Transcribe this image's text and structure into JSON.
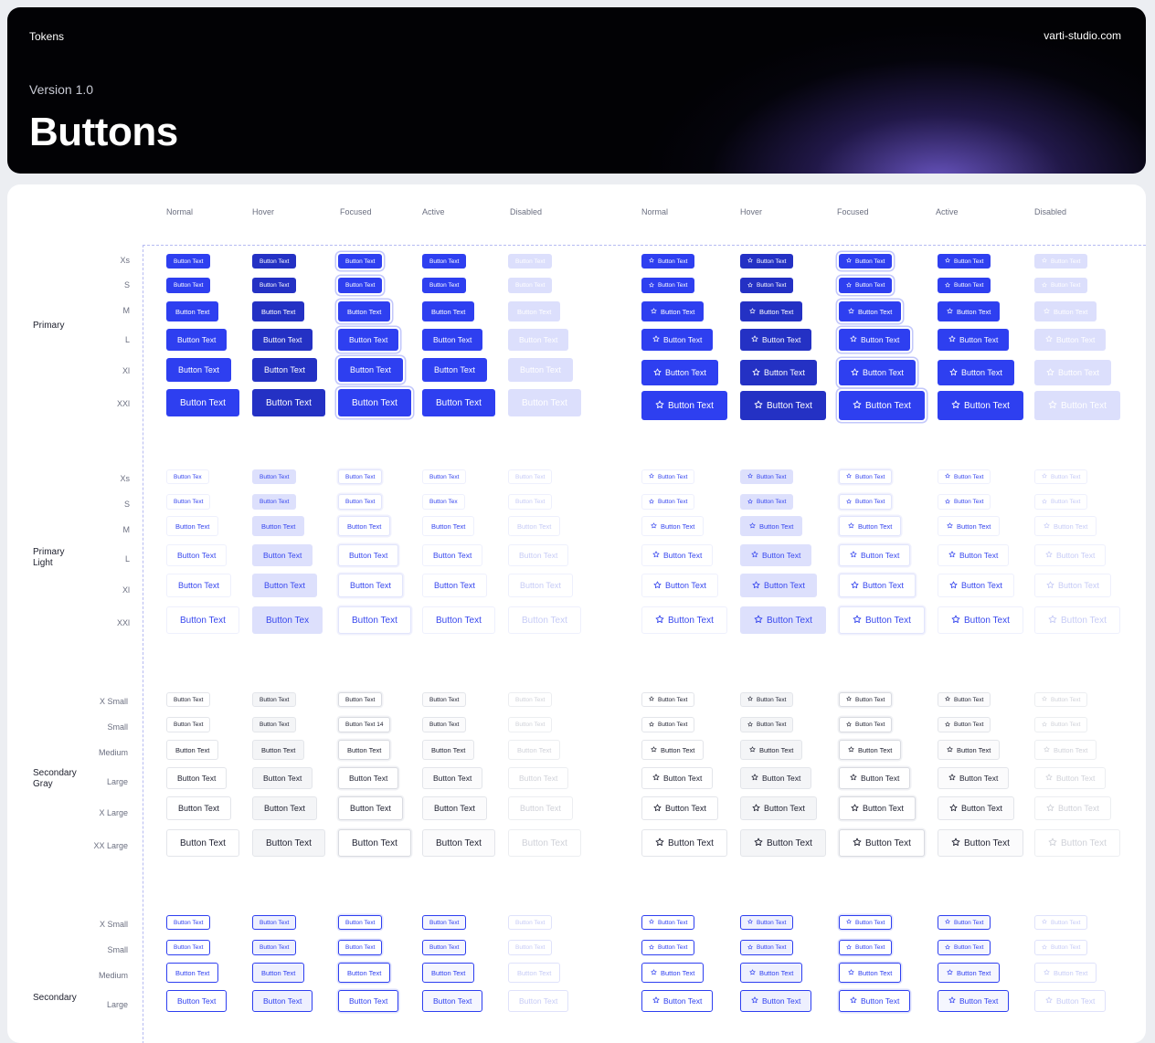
{
  "header": {
    "label": "Tokens",
    "site": "varti-studio.com",
    "version": "Version 1.0",
    "title": "Buttons"
  },
  "columns": [
    "Normal",
    "Hover",
    "Focused",
    "Active",
    "Disabled",
    "Normal",
    "Hover",
    "Focused",
    "Active",
    "Disabled"
  ],
  "states": [
    "normal",
    "hover",
    "focused",
    "active",
    "disabled"
  ],
  "icons": {
    "leading": "star-icon"
  },
  "colors": {
    "primary": "#2e3ff0",
    "primary_hover": "#2431c4",
    "primary_disabled": "#dcdffc",
    "light_hover": "#dde0fc"
  },
  "groups": [
    {
      "name": "Primary",
      "key": "primary",
      "sizes": [
        "Xs",
        "S",
        "M",
        "L",
        "Xl",
        "XXl"
      ],
      "labels": [
        [
          "Button Text",
          "Button Text",
          "Button Text",
          "Button Text",
          "Button Text",
          "Button Text",
          "Button Text",
          "Button Text",
          "Button Text",
          "Button Text"
        ],
        [
          "Button Text",
          "Button Text",
          "Button Text",
          "Button Text",
          "Button Text",
          "Button Text",
          "Button Text",
          "Button Text",
          "Button Text",
          "Button Text"
        ],
        [
          "Button Text",
          "Button Text",
          "Button Text",
          "Button Text",
          "Button Text",
          "Button Text",
          "Button Text",
          "Button Text",
          "Button Text",
          "Button Text"
        ],
        [
          "Button Text",
          "Button Text",
          "Button Text",
          "Button Text",
          "Button Text",
          "Button Text",
          "Button Text",
          "Button Text",
          "Button Text",
          "Button Text"
        ],
        [
          "Button Text",
          "Button Text",
          "Button Text",
          "Button Text",
          "Button Text",
          "Button Text",
          "Button Text",
          "Button Text",
          "Button Text",
          "Button Text"
        ],
        [
          "Button Text",
          "Button Text",
          "Button Text",
          "Button Text",
          "Button Text",
          "Button Text",
          "Button Text",
          "Button Text",
          "Button Text",
          "Button Text"
        ]
      ]
    },
    {
      "name": "Primary Light",
      "key": "light",
      "sizes": [
        "Xs",
        "S",
        "M",
        "L",
        "Xl",
        "XXl"
      ],
      "labels": [
        [
          "Button Tex",
          "Button Text",
          "Button Text",
          "Button Text",
          "Button Text",
          "Button Text",
          "Button Text",
          "Button Text",
          "Button Text",
          "Button Text"
        ],
        [
          "Button Text",
          "Button Text",
          "Button Text",
          "Button Tex",
          "Button Text",
          "Button Text",
          "Button Text",
          "Button Text",
          "Button Text",
          "Button Text"
        ],
        [
          "Button Text",
          "Button Text",
          "Button Text",
          "Button Text",
          "Button Text",
          "Button Text",
          "Button Text",
          "Button Text",
          "Button Text",
          "Button Text"
        ],
        [
          "Button Text",
          "Button Text",
          "Button Text",
          "Button Text",
          "Button Text",
          "Button Text",
          "Button Text",
          "Button Text",
          "Button Text",
          "Button Text"
        ],
        [
          "Button Text",
          "Button Text",
          "Button Text",
          "Button Text",
          "Button Text",
          "Button Text",
          "Button Text",
          "Button Text",
          "Button Text",
          "Button Text"
        ],
        [
          "Button Text",
          "Button Tex",
          "Button Text",
          "Button Text",
          "Button Text",
          "Button Text",
          "Button Text",
          "Button Text",
          "Button Text",
          "Button Text"
        ]
      ]
    },
    {
      "name": "Secondary Gray",
      "key": "gray",
      "sizes": [
        "X Small",
        "Small",
        "Medium",
        "Large",
        "X Large",
        "XX Large"
      ],
      "labels": [
        [
          "Button Text",
          "Button Text",
          "Button Text",
          "Button Text",
          "Button Text",
          "Button Text",
          "Button Text",
          "Button Text",
          "Button Text",
          "Button Text"
        ],
        [
          "Button Text",
          "Button Text",
          "Button Text 14",
          "Button Text",
          "Button Text",
          "Button Text",
          "Button Text",
          "Button Text",
          "Button Text",
          "Button Text"
        ],
        [
          "Button Text",
          "Button Text",
          "Button Text",
          "Button Text",
          "Button Text",
          "Button Text",
          "Button Text",
          "Button Text",
          "Button Text",
          "Button Text"
        ],
        [
          "Button Text",
          "Button Text",
          "Button Text",
          "Button Text",
          "Button Text",
          "Button Text",
          "Button Text",
          "Button Text",
          "Button Text",
          "Button Text"
        ],
        [
          "Button Text",
          "Button Text",
          "Button Text",
          "Button Text",
          "Button Text",
          "Button Text",
          "Button Text",
          "Button Text",
          "Button Text",
          "Button Text"
        ],
        [
          "Button Text",
          "Button Text",
          "Button Text",
          "Button Text",
          "Button Text",
          "Button Text",
          "Button Text",
          "Button Text",
          "Button Text",
          "Button Text"
        ]
      ]
    },
    {
      "name": "Secondary",
      "key": "sec",
      "sizes": [
        "X Small",
        "Small",
        "Medium",
        "Large"
      ],
      "labels": [
        [
          "Button Text",
          "Button Text",
          "Button Text",
          "Button Text",
          "Button Text",
          "Button Text",
          "Button Text",
          "Button Text",
          "Button Text",
          "Button Text"
        ],
        [
          "Button Text",
          "Button Text",
          "Button Text",
          "Button Text",
          "Button Text",
          "Button Text",
          "Button Text",
          "Button Text",
          "Button Text",
          "Button Text"
        ],
        [
          "Button Text",
          "Button Text",
          "Button Text",
          "Button Text",
          "Button Text",
          "Button Text",
          "Button Text",
          "Button Text",
          "Button Text",
          "Button Text"
        ],
        [
          "Button Text",
          "Button Text",
          "Button Text",
          "Button Text",
          "Button Text",
          "Button Text",
          "Button Text",
          "Button Text",
          "Button Text",
          "Button Text"
        ]
      ]
    }
  ]
}
